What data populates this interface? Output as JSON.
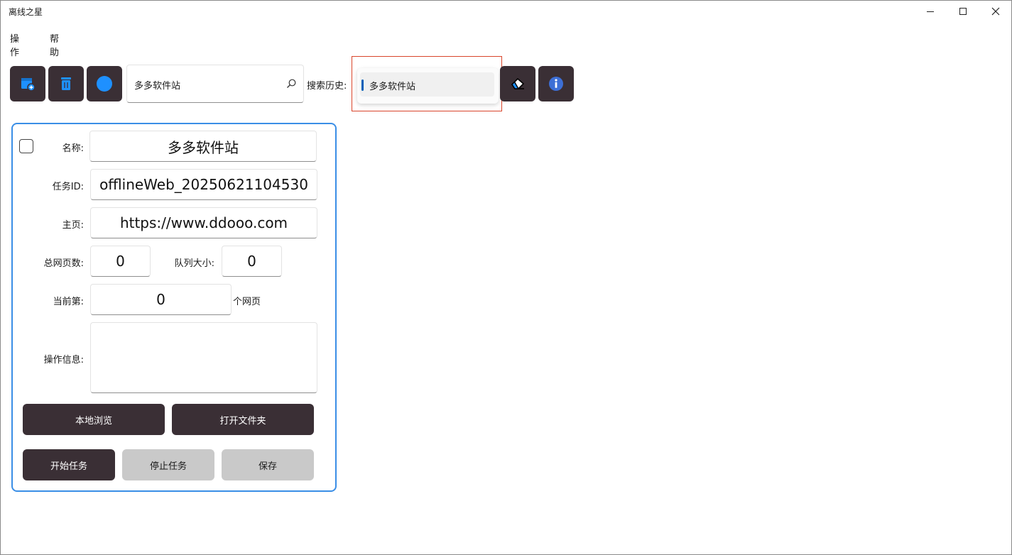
{
  "app": {
    "title": "离线之星"
  },
  "menu": {
    "items": [
      "操作",
      "帮助"
    ]
  },
  "toolbar": {
    "search_value": "多多软件站",
    "history_label": "搜索历史:",
    "history_selected": "多多软件站"
  },
  "task": {
    "name_label": "名称:",
    "name_value": "多多软件站",
    "id_label": "任务ID:",
    "id_value": "offlineWeb_20250621104530",
    "home_label": "主页:",
    "home_value": "https://www.ddooo.com",
    "total_label": "总网页数:",
    "total_value": "0",
    "queue_label": "队列大小:",
    "queue_value": "0",
    "current_label": "当前第:",
    "current_value": "0",
    "current_unit": "个网页",
    "info_label": "操作信息:",
    "info_value": ""
  },
  "buttons": {
    "local_browse": "本地浏览",
    "open_folder": "打开文件夹",
    "start_task": "开始任务",
    "stop_task": "停止任务",
    "save": "保存"
  },
  "colors": {
    "button_dark": "#3a2f35",
    "button_disabled": "#c9c9c9",
    "icon_blue": "#1e90ff",
    "panel_border": "#3a8ee6",
    "highlight_frame": "#d9452b"
  }
}
